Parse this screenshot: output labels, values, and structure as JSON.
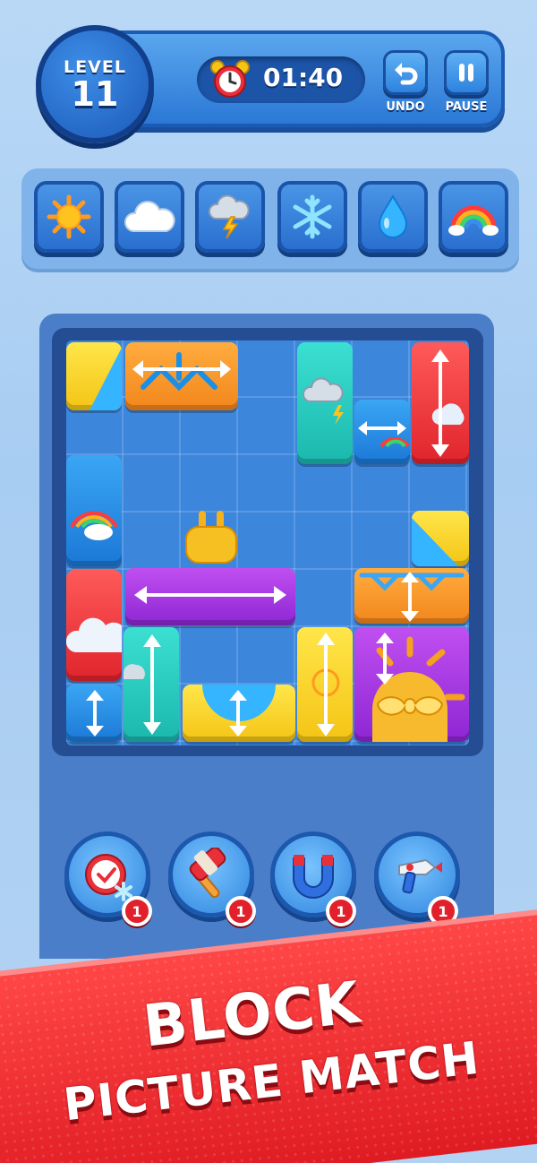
{
  "header": {
    "level_label": "LEVEL",
    "level_number": "11",
    "timer": "01:40",
    "undo_label": "UNDO",
    "pause_label": "PAUSE"
  },
  "targets": [
    {
      "name": "sun-icon"
    },
    {
      "name": "cloud-icon"
    },
    {
      "name": "thunderstorm-icon"
    },
    {
      "name": "snowflake-icon"
    },
    {
      "name": "water-drop-icon"
    },
    {
      "name": "rainbow-icon"
    }
  ],
  "boosters": [
    {
      "name": "freeze-timer-booster",
      "count": "1"
    },
    {
      "name": "hammer-booster",
      "count": "1"
    },
    {
      "name": "magnet-booster",
      "count": "1"
    },
    {
      "name": "rocket-blaster-booster",
      "count": "1"
    }
  ],
  "banner": {
    "line1": "BLOCK",
    "line2": "PICTURE MATCH"
  },
  "colors": {
    "board": "#3c86dc",
    "banner": "#e52a2e",
    "yellow_block": "#f9d422",
    "orange_block": "#f7931f",
    "teal_block": "#23c9be",
    "red_block": "#ee3038",
    "blue_block": "#2a8ee6",
    "purple_block": "#a93ae2"
  }
}
